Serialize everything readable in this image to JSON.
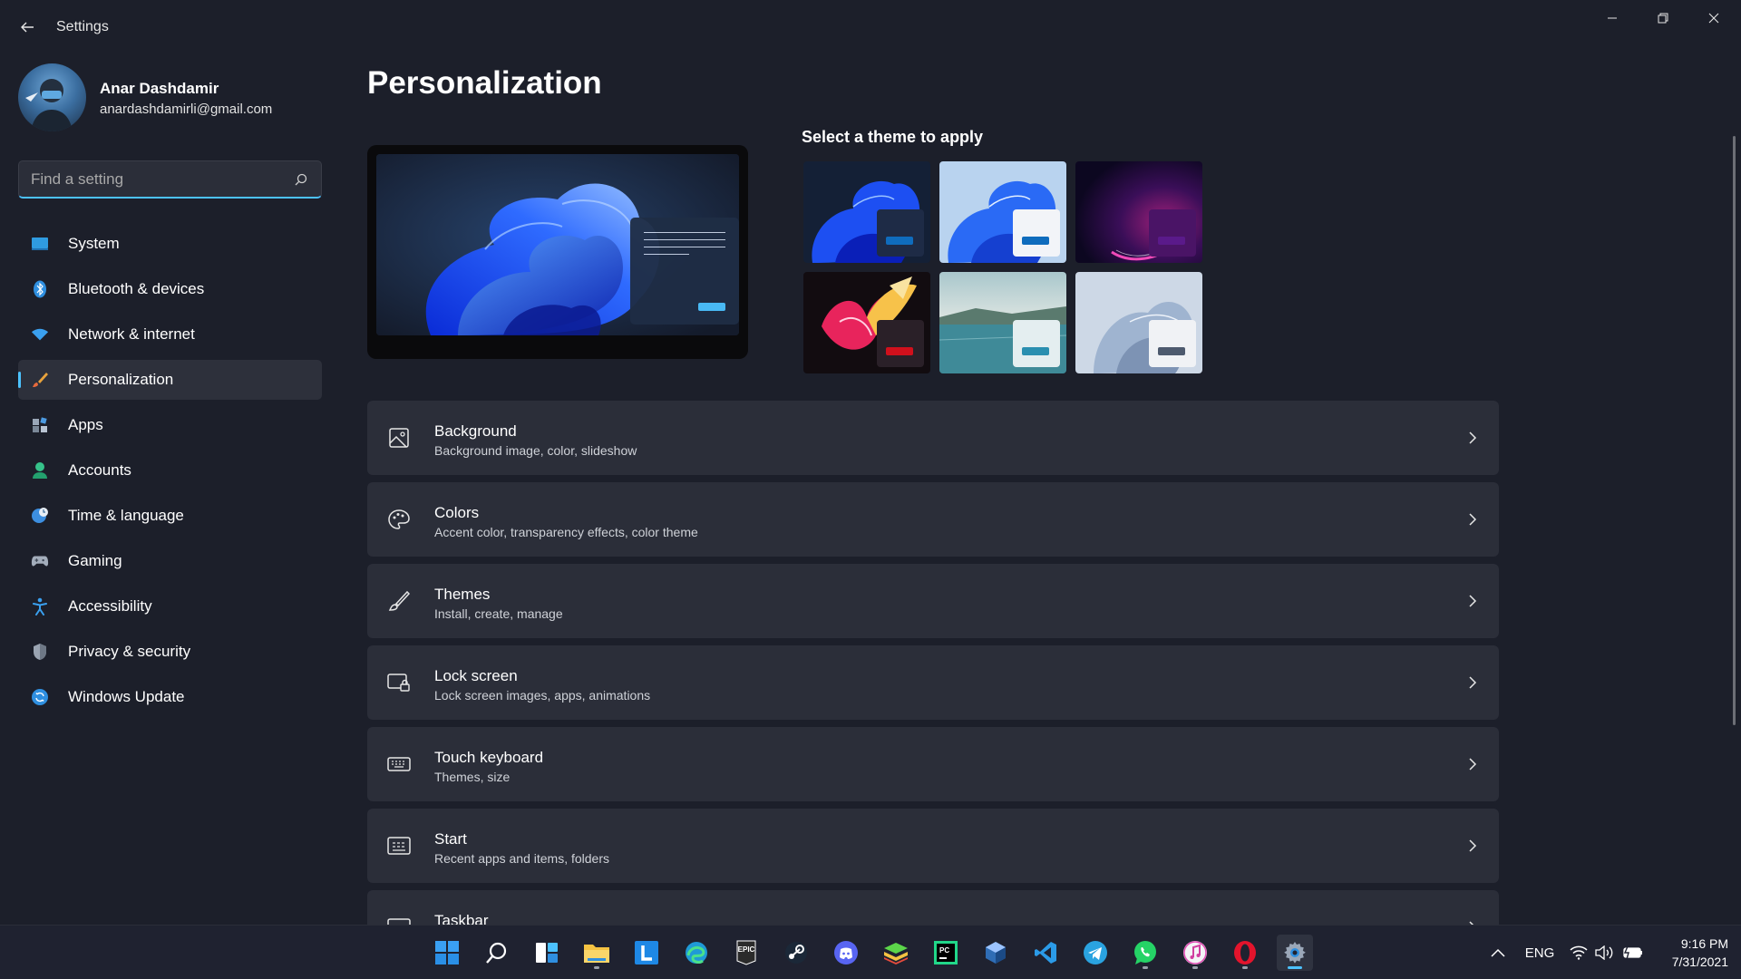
{
  "window": {
    "title": "Settings"
  },
  "user": {
    "name": "Anar Dashdamir",
    "email": "anardashdamirli@gmail.com"
  },
  "search": {
    "placeholder": "Find a setting"
  },
  "sidebar": {
    "items": [
      {
        "label": "System",
        "icon": "system-icon"
      },
      {
        "label": "Bluetooth & devices",
        "icon": "bluetooth-icon"
      },
      {
        "label": "Network & internet",
        "icon": "wifi-icon"
      },
      {
        "label": "Personalization",
        "icon": "brush-icon",
        "active": true
      },
      {
        "label": "Apps",
        "icon": "apps-icon"
      },
      {
        "label": "Accounts",
        "icon": "accounts-icon"
      },
      {
        "label": "Time & language",
        "icon": "globe-clock-icon"
      },
      {
        "label": "Gaming",
        "icon": "gamepad-icon"
      },
      {
        "label": "Accessibility",
        "icon": "accessibility-icon"
      },
      {
        "label": "Privacy & security",
        "icon": "shield-icon"
      },
      {
        "label": "Windows Update",
        "icon": "update-icon"
      }
    ]
  },
  "main": {
    "title": "Personalization",
    "themes_label": "Select a theme to apply",
    "themes": [
      {
        "name": "windows-dark",
        "accent": "#0f6cbd"
      },
      {
        "name": "windows-light",
        "accent": "#0f6cbd"
      },
      {
        "name": "glow",
        "accent": "#5a1a8a"
      },
      {
        "name": "captured-motion",
        "accent": "#d0101c"
      },
      {
        "name": "sunrise",
        "accent": "#2a8fb0"
      },
      {
        "name": "flow",
        "accent": "#4d5a6e"
      }
    ],
    "cards": [
      {
        "title": "Background",
        "subtitle": "Background image, color, slideshow",
        "icon": "image-icon"
      },
      {
        "title": "Colors",
        "subtitle": "Accent color, transparency effects, color theme",
        "icon": "palette-icon"
      },
      {
        "title": "Themes",
        "subtitle": "Install, create, manage",
        "icon": "brush-icon"
      },
      {
        "title": "Lock screen",
        "subtitle": "Lock screen images, apps, animations",
        "icon": "lock-screen-icon"
      },
      {
        "title": "Touch keyboard",
        "subtitle": "Themes, size",
        "icon": "keyboard-icon"
      },
      {
        "title": "Start",
        "subtitle": "Recent apps and items, folders",
        "icon": "start-icon"
      },
      {
        "title": "Taskbar",
        "subtitle": "",
        "icon": "taskbar-icon"
      }
    ]
  },
  "taskbar": {
    "apps": [
      "start",
      "search",
      "widgets",
      "file-explorer",
      "lisk",
      "edge",
      "epic-games",
      "steam",
      "discord",
      "bluestacks",
      "pycharm",
      "virtualbox",
      "vscode",
      "telegram",
      "whatsapp",
      "itunes",
      "opera",
      "settings"
    ],
    "language": "ENG",
    "time": "9:16 PM",
    "date": "7/31/2021"
  },
  "colors": {
    "accent": "#4cc2ff",
    "background": "#1c1f2a",
    "card": "#2b2e39"
  }
}
